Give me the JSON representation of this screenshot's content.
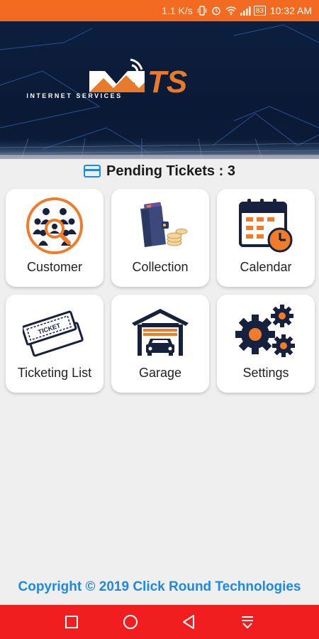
{
  "status_bar": {
    "net_speed": "1.1 K/s",
    "battery": "83",
    "time": "10:32 AM"
  },
  "brand": {
    "logo_letters": "TS",
    "tagline": "INTERNET SERVICES"
  },
  "pending": {
    "label": "Pending Tickets : 3"
  },
  "menu": {
    "items": [
      {
        "label": "Customer",
        "icon": "customer-search-icon"
      },
      {
        "label": "Collection",
        "icon": "wallet-coins-icon"
      },
      {
        "label": "Calendar",
        "icon": "calendar-clock-icon"
      },
      {
        "label": "Ticketing List",
        "icon": "ticket-icon"
      },
      {
        "label": "Garage",
        "icon": "garage-car-icon"
      },
      {
        "label": "Settings",
        "icon": "gears-icon"
      }
    ]
  },
  "footer": {
    "copyright": "Copyright © 2019 Click Round Technologies"
  },
  "colors": {
    "status_bar": "#f26b21",
    "accent_orange": "#f07c2a",
    "dark_navy": "#16213e",
    "link_blue": "#1e88e5",
    "nav_bar": "#f01e1e"
  }
}
